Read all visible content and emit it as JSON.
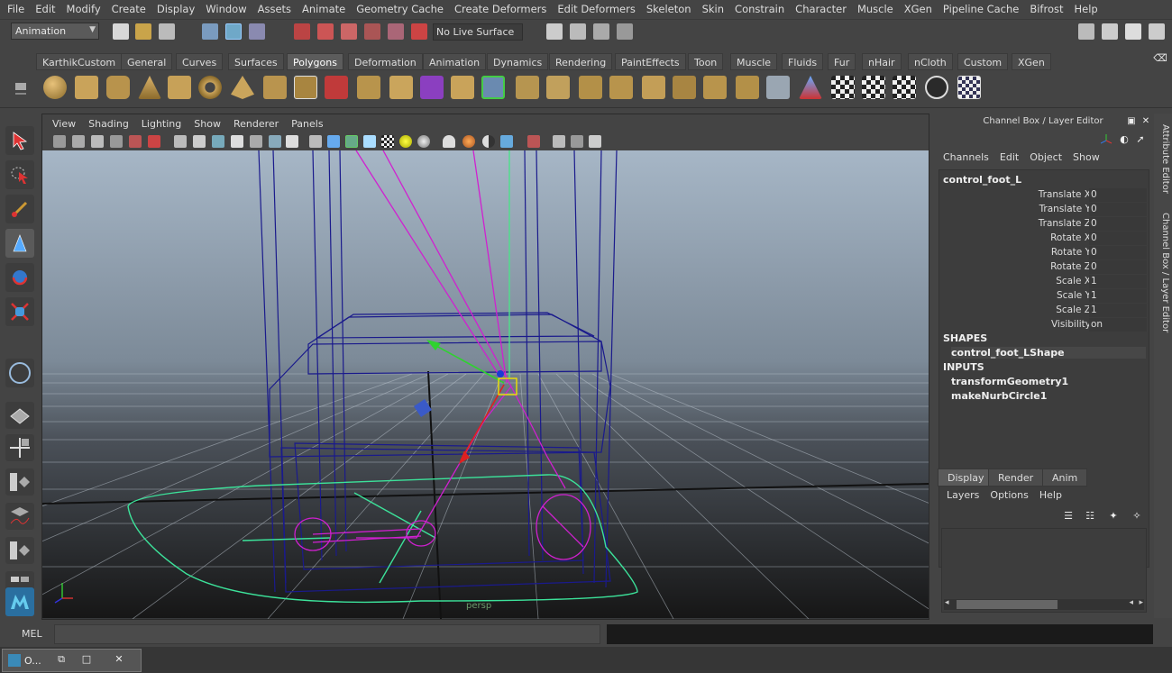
{
  "menubar": [
    "File",
    "Edit",
    "Modify",
    "Create",
    "Display",
    "Window",
    "Assets",
    "Animate",
    "Geometry Cache",
    "Create Deformers",
    "Edit Deformers",
    "Skeleton",
    "Skin",
    "Constrain",
    "Character",
    "Muscle",
    "XGen",
    "Pipeline Cache",
    "Bifrost",
    "Help"
  ],
  "status": {
    "mode": "Animation",
    "live_surface": "No Live Surface"
  },
  "shelf_tabs": [
    "KarthikCustom",
    "General",
    "Curves",
    "Surfaces",
    "Polygons",
    "Deformation",
    "Animation",
    "Dynamics",
    "Rendering",
    "PaintEffects",
    "Toon",
    "Muscle",
    "Fluids",
    "Fur",
    "nHair",
    "nCloth",
    "Custom",
    "XGen"
  ],
  "active_shelf": "Polygons",
  "viewport": {
    "menu": [
      "View",
      "Shading",
      "Lighting",
      "Show",
      "Renderer",
      "Panels"
    ],
    "camera": "persp"
  },
  "channel_box": {
    "title": "Channel Box / Layer Editor",
    "menu": [
      "Channels",
      "Edit",
      "Object",
      "Show"
    ],
    "node": "control_foot_L",
    "channels": [
      {
        "name": "Translate X",
        "value": "0"
      },
      {
        "name": "Translate Y",
        "value": "0"
      },
      {
        "name": "Translate Z",
        "value": "0"
      },
      {
        "name": "Rotate X",
        "value": "0"
      },
      {
        "name": "Rotate Y",
        "value": "0"
      },
      {
        "name": "Rotate Z",
        "value": "0"
      },
      {
        "name": "Scale X",
        "value": "1"
      },
      {
        "name": "Scale Y",
        "value": "1"
      },
      {
        "name": "Scale Z",
        "value": "1"
      },
      {
        "name": "Visibility",
        "value": "on"
      }
    ],
    "shapes_label": "SHAPES",
    "shape": "control_foot_LShape",
    "inputs_label": "INPUTS",
    "inputs": [
      "transformGeometry1",
      "makeNurbCircle1"
    ]
  },
  "layer_editor": {
    "tabs": [
      "Display",
      "Render",
      "Anim"
    ],
    "menu": [
      "Layers",
      "Options",
      "Help"
    ]
  },
  "side_tabs": [
    "Attribute Editor",
    "Channel Box / Layer Editor"
  ],
  "command_line": {
    "label": "MEL"
  },
  "taskbar": {
    "window_label": "O..."
  }
}
